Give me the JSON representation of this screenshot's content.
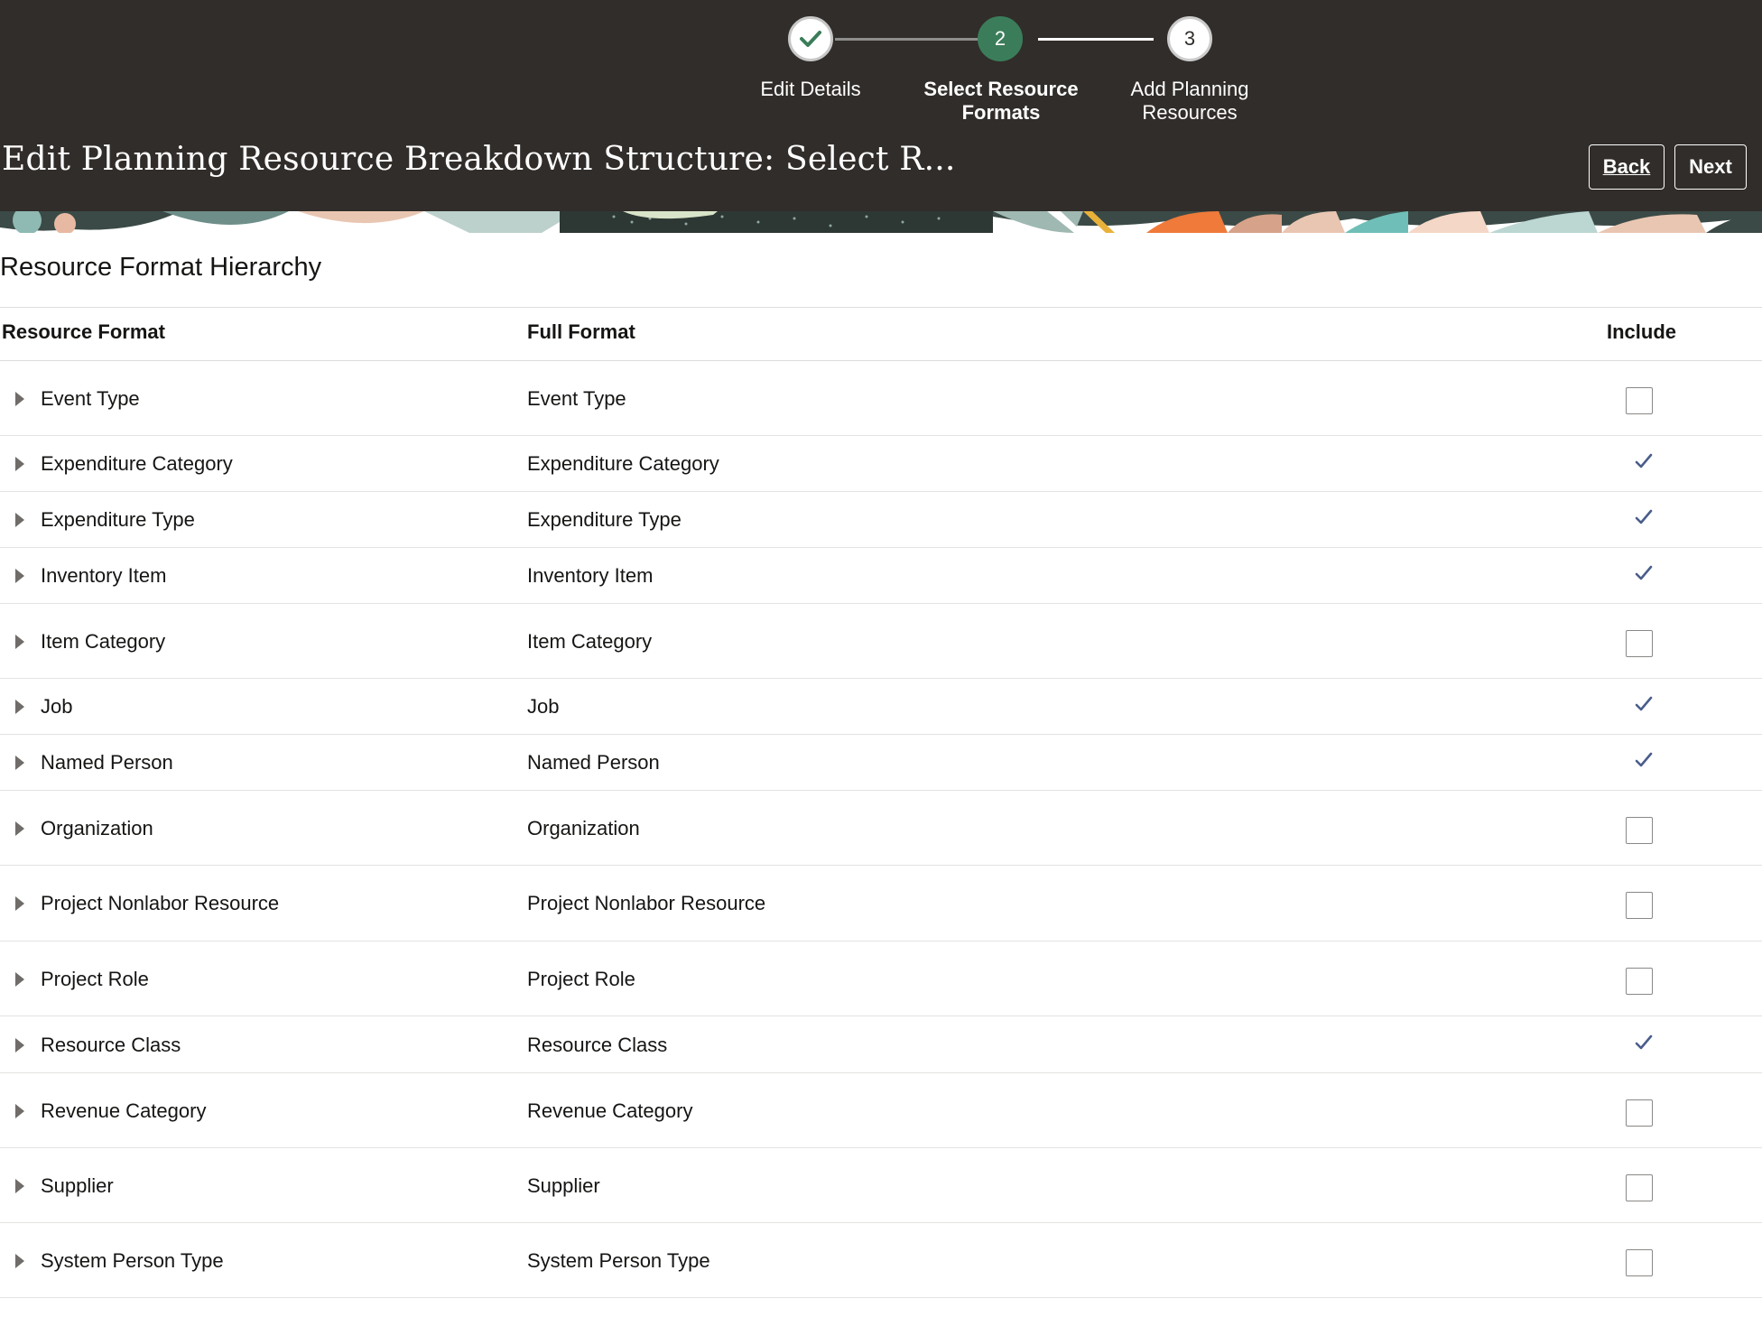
{
  "train": {
    "stops": [
      {
        "number": "",
        "label": "Edit Details",
        "state": "done",
        "icon": "check-icon"
      },
      {
        "number": "2",
        "label": "Select Resource Formats",
        "state": "current"
      },
      {
        "number": "3",
        "label": "Add Planning Resources",
        "state": "todo"
      }
    ]
  },
  "header": {
    "title": "Edit Planning Resource Breakdown Structure: Select R...",
    "back_label": "Back",
    "next_label": "Next"
  },
  "section": {
    "title": "Resource Format Hierarchy"
  },
  "table": {
    "columns": {
      "resource_format": "Resource Format",
      "full_format": "Full Format",
      "include": "Include"
    },
    "rows": [
      {
        "resource_format": "Event Type",
        "full_format": "Event Type",
        "include": false
      },
      {
        "resource_format": "Expenditure Category",
        "full_format": "Expenditure Category",
        "include": true
      },
      {
        "resource_format": "Expenditure Type",
        "full_format": "Expenditure Type",
        "include": true
      },
      {
        "resource_format": "Inventory Item",
        "full_format": "Inventory Item",
        "include": true
      },
      {
        "resource_format": "Item Category",
        "full_format": "Item Category",
        "include": false
      },
      {
        "resource_format": "Job",
        "full_format": "Job",
        "include": true
      },
      {
        "resource_format": "Named Person",
        "full_format": "Named Person",
        "include": true
      },
      {
        "resource_format": "Organization",
        "full_format": "Organization",
        "include": false
      },
      {
        "resource_format": "Project Nonlabor Resource",
        "full_format": "Project Nonlabor Resource",
        "include": false
      },
      {
        "resource_format": "Project Role",
        "full_format": "Project Role",
        "include": false
      },
      {
        "resource_format": "Resource Class",
        "full_format": "Resource Class",
        "include": true
      },
      {
        "resource_format": "Revenue Category",
        "full_format": "Revenue Category",
        "include": false
      },
      {
        "resource_format": "Supplier",
        "full_format": "Supplier",
        "include": false
      },
      {
        "resource_format": "System Person Type",
        "full_format": "System Person Type",
        "include": false
      }
    ]
  },
  "colors": {
    "header_bg": "#312d2a",
    "current_step": "#3b7d5a",
    "check_mark": "#3b7d5a",
    "include_tick": "#4a5d8c"
  }
}
